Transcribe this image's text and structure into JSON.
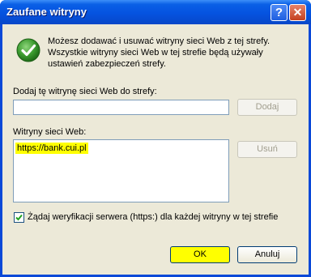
{
  "dialog": {
    "title": "Zaufane witryny",
    "help_glyph": "?",
    "close_glyph": "✕"
  },
  "info": {
    "text": "Możesz dodawać i usuwać witryny sieci Web z tej strefy. Wszystkie witryny sieci Web w tej strefie będą używały ustawień zabezpieczeń strefy.",
    "icon": "green-check-icon"
  },
  "add_section": {
    "label": "Dodaj tę witrynę sieci Web do strefy:",
    "input_value": "",
    "add_button": "Dodaj"
  },
  "sites_section": {
    "label": "Witryny sieci Web:",
    "items": [
      "https://bank.cui.pl"
    ],
    "remove_button": "Usuń"
  },
  "verify": {
    "checked": true,
    "label": "Żądaj weryfikacji serwera (https:) dla każdej witryny w tej strefie"
  },
  "buttons": {
    "ok": "OK",
    "cancel": "Anuluj"
  },
  "colors": {
    "title_bar": "#0553e0",
    "dialog_face": "#ece9d8",
    "highlight": "#ffff00",
    "check_green": "#3a9a2e"
  }
}
